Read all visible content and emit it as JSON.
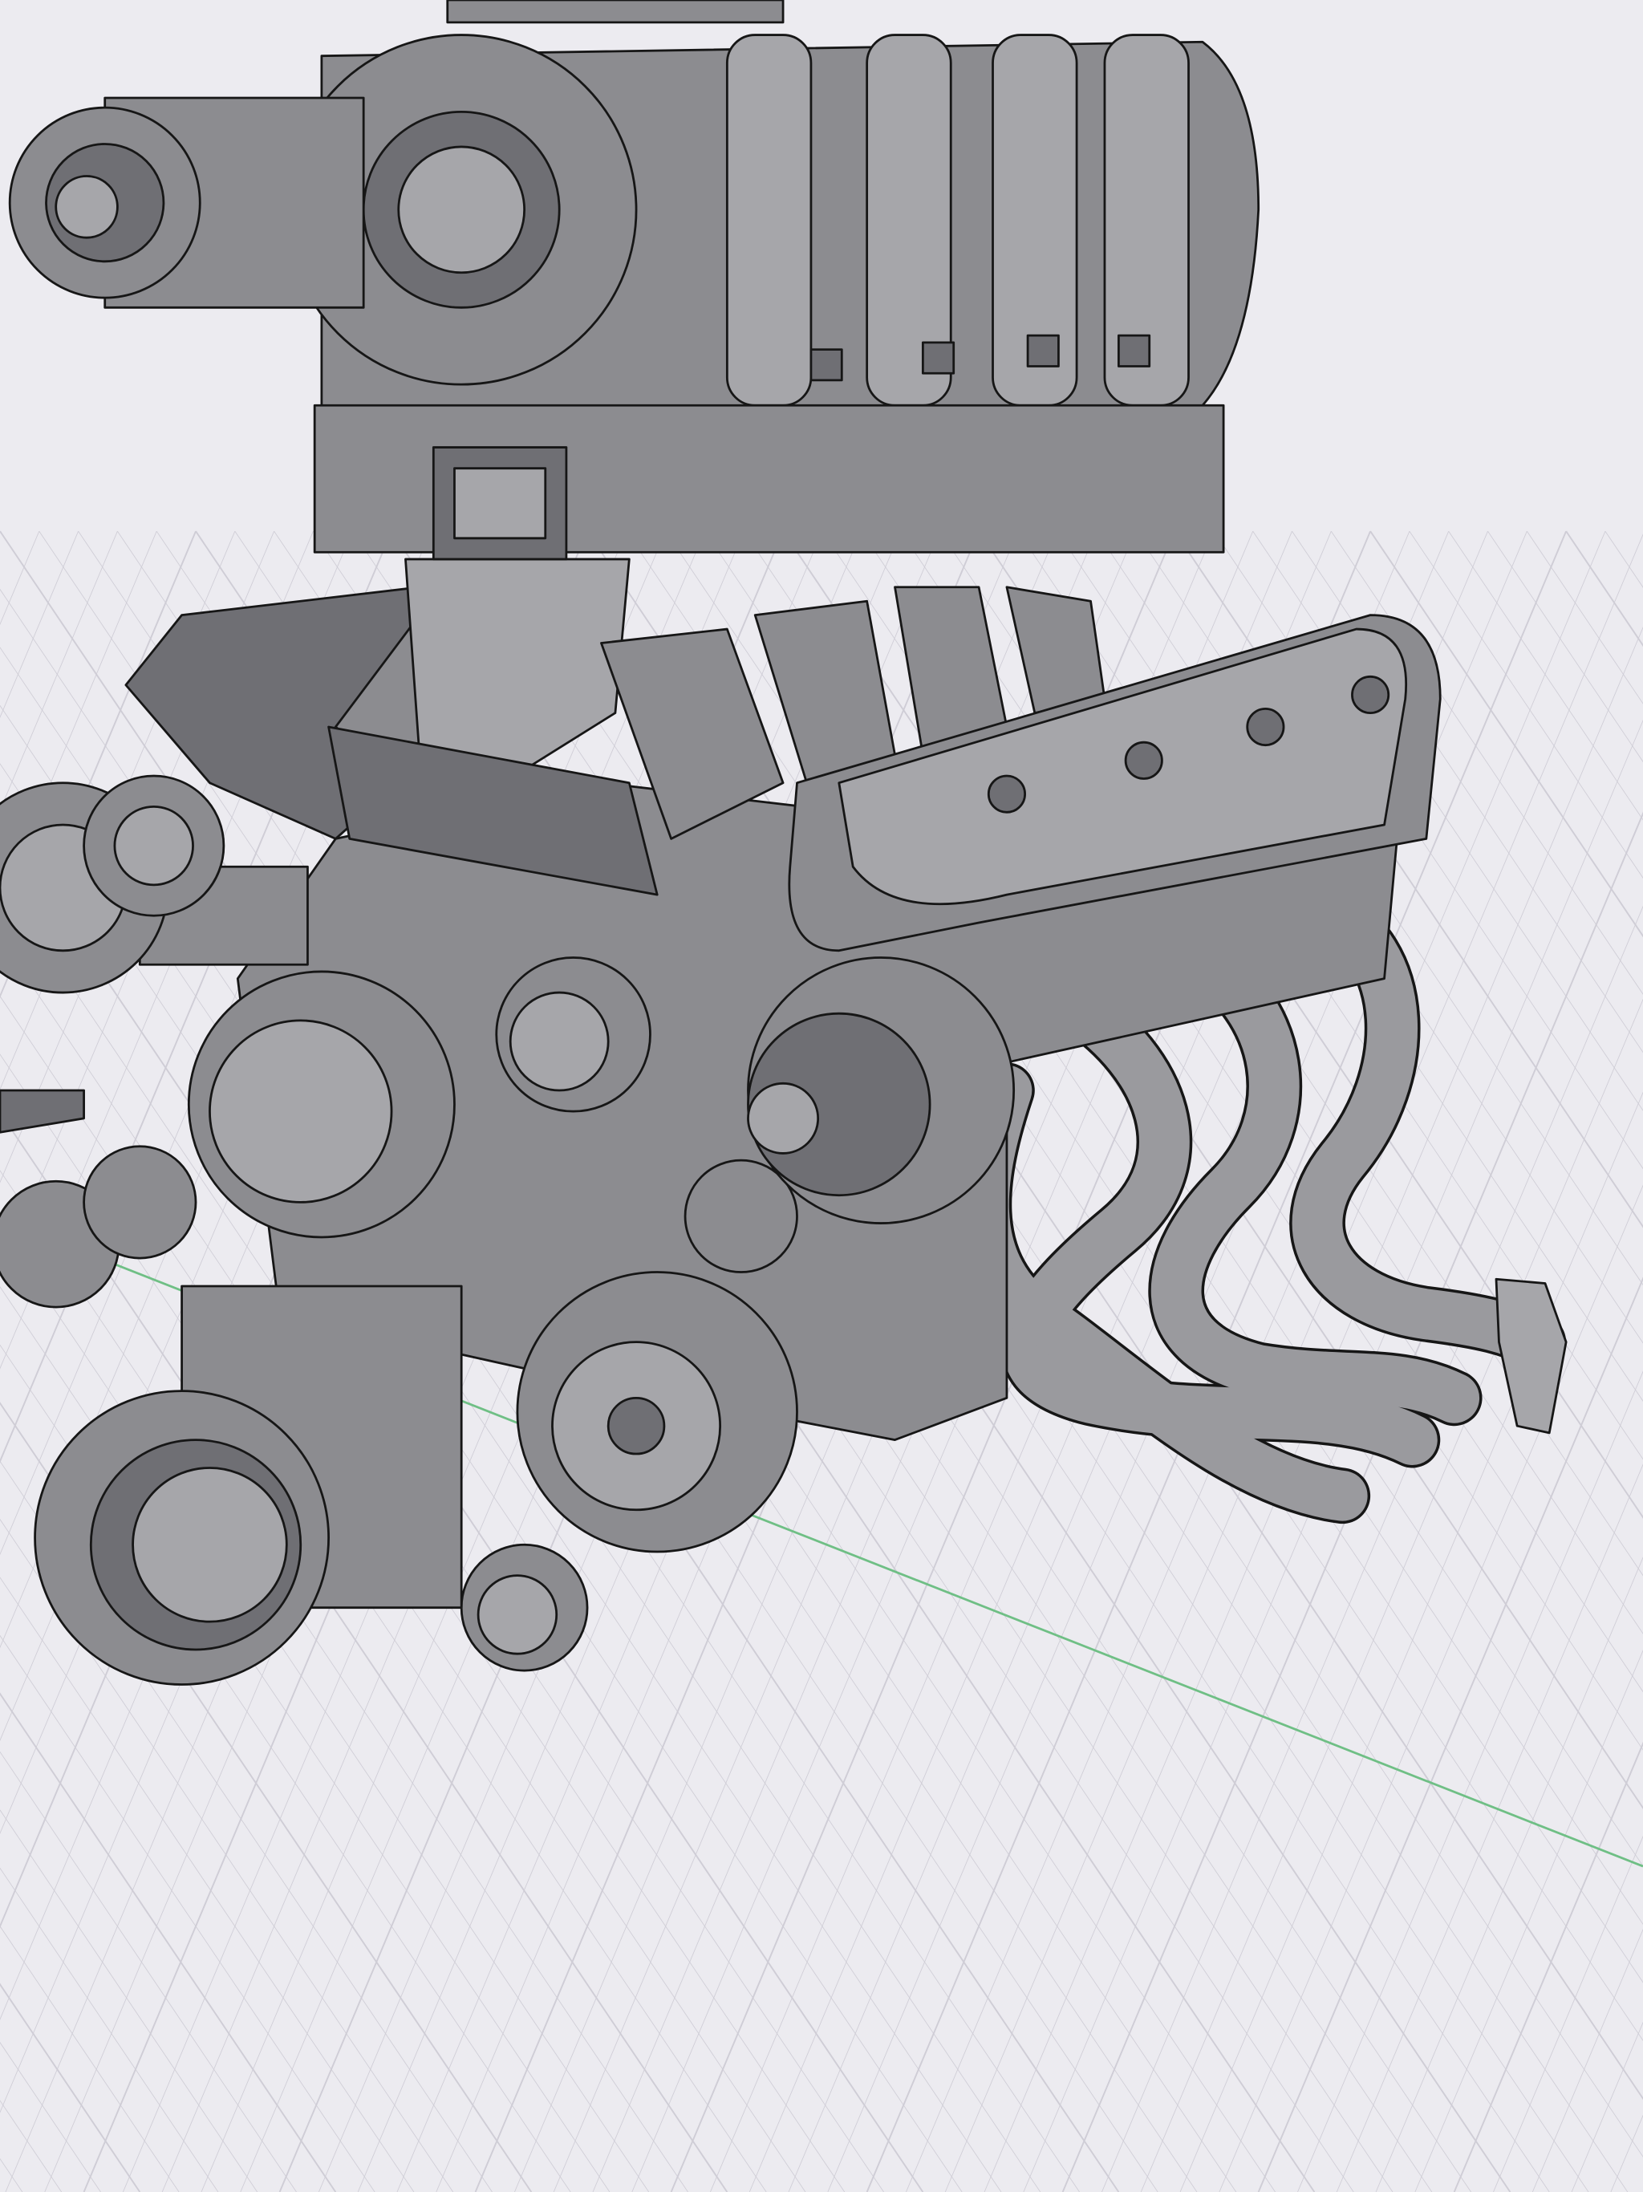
{
  "viewport": {
    "background_color": "#ecebf0",
    "grid_line_color": "#cfcdd6",
    "axis_color": "#6fbf85",
    "model_color": "#8c8c90",
    "edge_color": "#161616"
  }
}
